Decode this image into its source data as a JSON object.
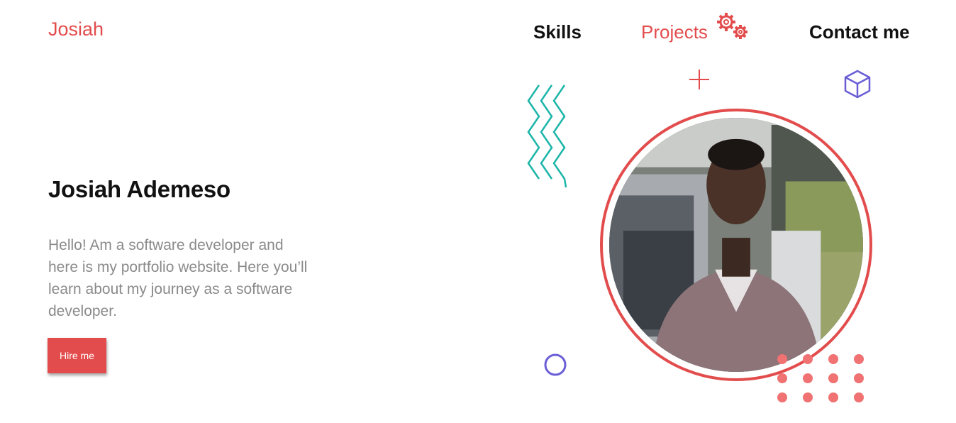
{
  "header": {
    "logo": "Josiah",
    "nav": [
      {
        "label": "Skills"
      },
      {
        "label": "Projects",
        "icon": "gears-icon"
      },
      {
        "label": "Contact me"
      }
    ]
  },
  "hero": {
    "name": "Josiah Ademeso",
    "intro": "Hello! Am a software developer and here is my portfolio website. Here you’ll learn about my journey as a software developer.",
    "button_label": "Hire me",
    "photo_alt": "Josiah Ademeso"
  },
  "decorations": [
    "zigzag-icon",
    "plus-icon",
    "cube-icon",
    "circle-icon",
    "dot-grid-icon"
  ],
  "colors": {
    "accent": "#e34c4c",
    "teal": "#1bb5a8",
    "purple": "#6a5ed6",
    "text": "#111111",
    "muted": "#8a8a8a"
  }
}
